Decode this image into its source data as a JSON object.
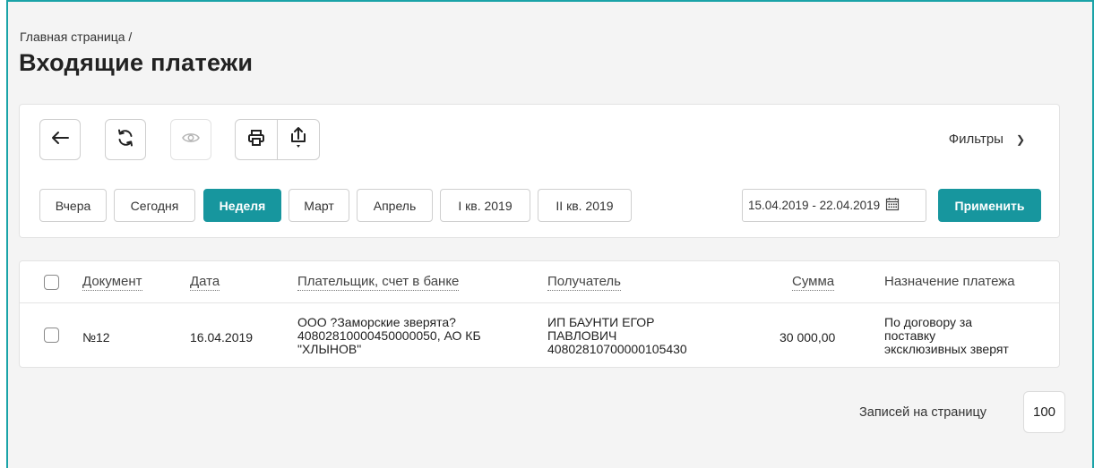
{
  "breadcrumb": {
    "home_label": "Главная страница",
    "separator": "/"
  },
  "page": {
    "title": "Входящие платежи"
  },
  "toolbar": {
    "icons": {
      "back": "arrow-left-icon",
      "refresh": "refresh-icon",
      "view": "eye-icon",
      "print": "printer-icon",
      "export": "upload-icon"
    },
    "filters_label": "Фильтры",
    "filters_chevron": "❯"
  },
  "periods": {
    "items": [
      "Вчера",
      "Сегодня",
      "Неделя",
      "Март",
      "Апрель",
      "I кв. 2019",
      "II кв. 2019"
    ],
    "active": "Неделя"
  },
  "date_range": {
    "value": "15.04.2019 - 22.04.2019",
    "icon": "calendar-icon"
  },
  "apply_label": "Применить",
  "table": {
    "columns": [
      "Документ",
      "Дата",
      "Плательщик, счет в банке",
      "Получатель",
      "Сумма",
      "Назначение платежа"
    ],
    "rows": [
      {
        "document": "№12",
        "date": "16.04.2019",
        "payer_line1": "ООО ?Заморские зверята?",
        "payer_line2": "40802810000450000050, АО КБ",
        "payer_line3": "\"ХЛЫНОВ\"",
        "recipient_line1": "ИП БАУНТИ ЕГОР",
        "recipient_line2": "ПАВЛОВИЧ",
        "recipient_line3": "40802810700000105430",
        "amount": "30 000,00",
        "purpose_line1": "По договору за",
        "purpose_line2": "поставку",
        "purpose_line3": "эксклюзивных зверят"
      }
    ]
  },
  "pagination": {
    "per_page_label": "Записей на страницу",
    "per_page_value": "100"
  },
  "colors": {
    "accent": "#17969e",
    "frame": "#1aa3a8",
    "background": "#f4f4f4"
  }
}
